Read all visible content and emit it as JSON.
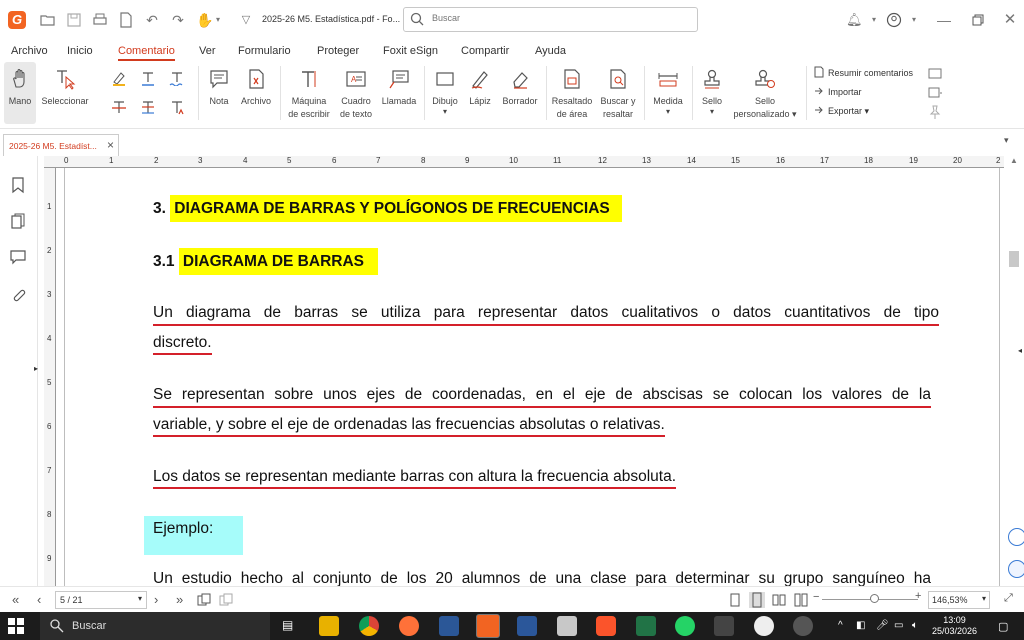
{
  "titlebar": {
    "document_title": "2025-26 M5. Estadística.pdf - Fo...",
    "search_placeholder": "Buscar"
  },
  "menu": {
    "tabs": [
      {
        "label": "Archivo"
      },
      {
        "label": "Inicio"
      },
      {
        "label": "Comentario",
        "active": true
      },
      {
        "label": "Ver"
      },
      {
        "label": "Formulario"
      },
      {
        "label": "Proteger"
      },
      {
        "label": "Foxit eSign"
      },
      {
        "label": "Compartir"
      },
      {
        "label": "Ayuda"
      }
    ]
  },
  "ribbon": {
    "mano": "Mano",
    "seleccionar": "Seleccionar",
    "nota": "Nota",
    "archivo": "Archivo",
    "maquina_1": "Máquina",
    "maquina_2": "de escribir",
    "cuadro_1": "Cuadro",
    "cuadro_2": "de texto",
    "llamada": "Llamada",
    "dibujo": "Dibujo",
    "lapiz": "Lápiz",
    "borrador": "Borrador",
    "resaltado_1": "Resaltado",
    "resaltado_2": "de área",
    "buscar_1": "Buscar y",
    "buscar_2": "resaltar",
    "medida": "Medida",
    "sello": "Sello",
    "sello_p_1": "Sello",
    "sello_p_2": "personalizado",
    "resumir": "Resumir comentarios",
    "importar": "Importar",
    "exportar": "Exportar"
  },
  "doc_tab": {
    "label": "2025-26 M5. Estadíst..."
  },
  "ruler": {
    "h_ticks": [
      "0",
      "1",
      "2",
      "3",
      "4",
      "5",
      "6",
      "7",
      "8",
      "9",
      "10",
      "11",
      "12",
      "13",
      "14",
      "15",
      "16",
      "17",
      "18",
      "19",
      "20",
      "2"
    ],
    "v_ticks": [
      "1",
      "2",
      "3",
      "4",
      "5",
      "6",
      "7",
      "8",
      "9"
    ]
  },
  "document": {
    "heading3_num": "3.",
    "heading3_text": "DIAGRAMA DE BARRAS Y POLÍGONOS DE FRECUENCIAS",
    "heading31_num": "3.1",
    "heading31_text": "DIAGRAMA DE BARRAS",
    "p1_line1": "Un diagrama de barras se utiliza para representar datos cualitativos o datos cuantitativos de tipo",
    "p1_line2": "discreto.",
    "p2_line1": "Se representan sobre unos ejes de coordenadas, en el eje de abscisas se colocan los valores de la",
    "p2_line2": "variable, y sobre el eje de ordenadas las frecuencias absolutas o relativas.",
    "p3_line1": "Los datos se representan mediante barras con altura la frecuencia absoluta.",
    "ejemplo": "Ejemplo:",
    "p4_line1": "Un estudio hecho al conjunto de los 20 alumnos de una clase para determinar su grupo sanguíneo ha"
  },
  "status": {
    "page": "5 / 21",
    "zoom": "146,53%"
  },
  "taskbar": {
    "search": "Buscar",
    "time": "13:09",
    "date": "25/03/2026"
  },
  "colors": {
    "accent": "#d23b1e",
    "highlight_yellow": "#ffff00",
    "highlight_cyan": "#a6fcfa",
    "underline_red": "#d4202a"
  }
}
